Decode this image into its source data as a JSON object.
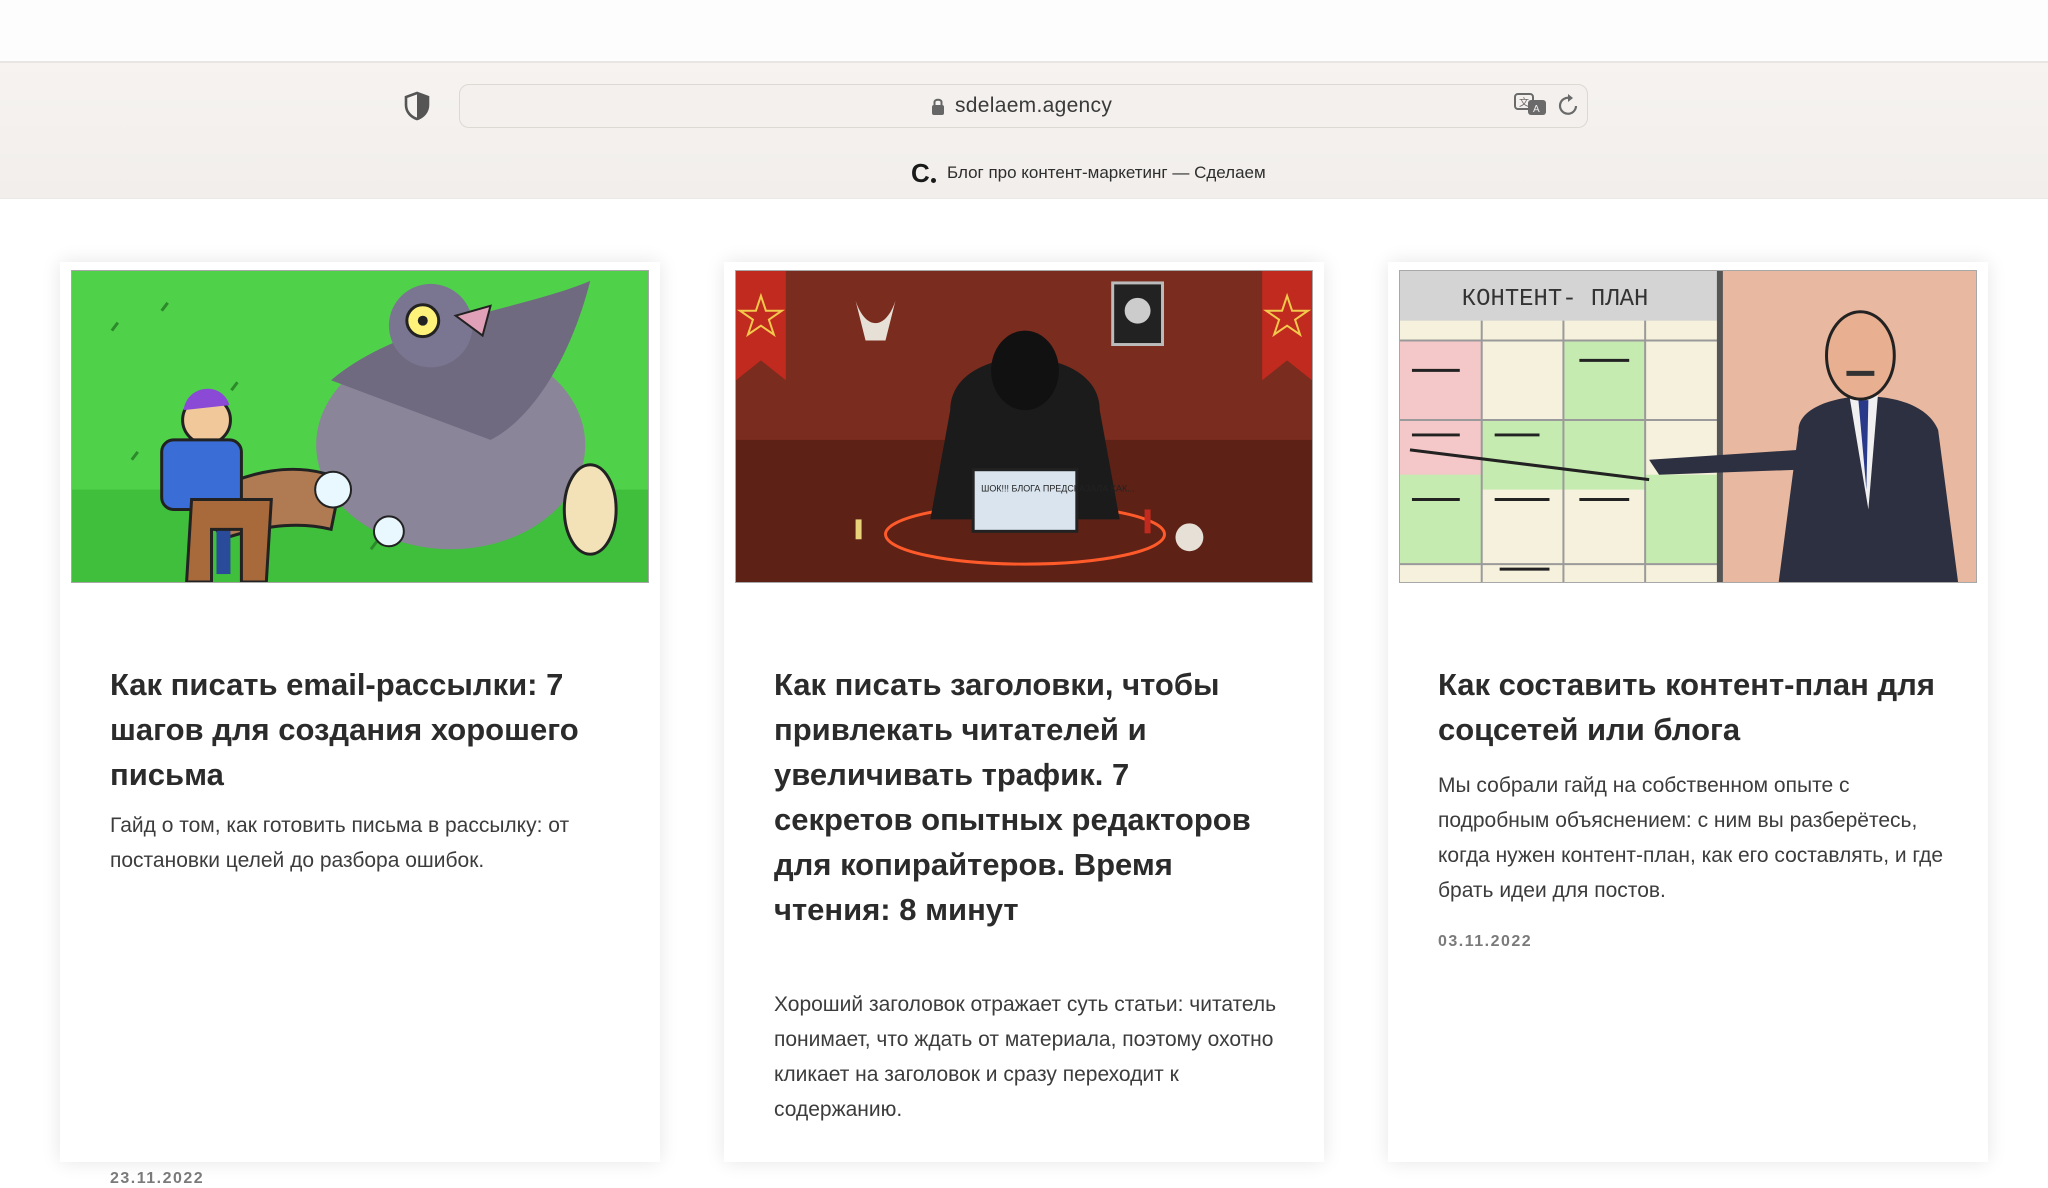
{
  "browser": {
    "url": "sdelaem.agency",
    "tab_title": "Блог про контент-маркетинг — Сделаем",
    "tab_favicon": "C",
    "icons": {
      "shield": "shield-icon",
      "lock": "lock-icon",
      "translate": "translate-icon",
      "reload": "reload-icon"
    }
  },
  "cards": [
    {
      "title": "Как писать email-рассылки: 7 шагов для создания хорошего письма",
      "description": "Гайд о том, как готовить письма в рассылку: от постановки целей до разбора ошибок.",
      "date": "23.11.2022"
    },
    {
      "title": "Как писать заголовки, чтобы привлекать читателей и увеличивать трафик. 7 секретов опытных редакторов для копирайтеров. Время чтения: 8 минут",
      "description": "Хороший заголовок отражает суть статьи: читатель понимает, что ждать от материала, поэтому охотно кликает на заголовок и сразу переходит к содержанию.",
      "image_text": "ШОК!!! БЛОГА ПРЕДСКАЗАЛА КАК..."
    },
    {
      "title": "Как составить контент-план для соцсетей или блога",
      "description": "Мы собрали гайд на собственном опыте с подробным объяснением: с ним вы разберётесь, когда нужен контент-план, как его составлять, и где брать идеи для постов.",
      "date": "03.11.2022",
      "image_text": "КОНТЕНТ- ПЛАН"
    }
  ],
  "colors": {
    "page_bg": "#ffffff",
    "browser_bar": "#f3f0ed",
    "text": "#2b2b2b",
    "date": "#7a7a7a"
  }
}
